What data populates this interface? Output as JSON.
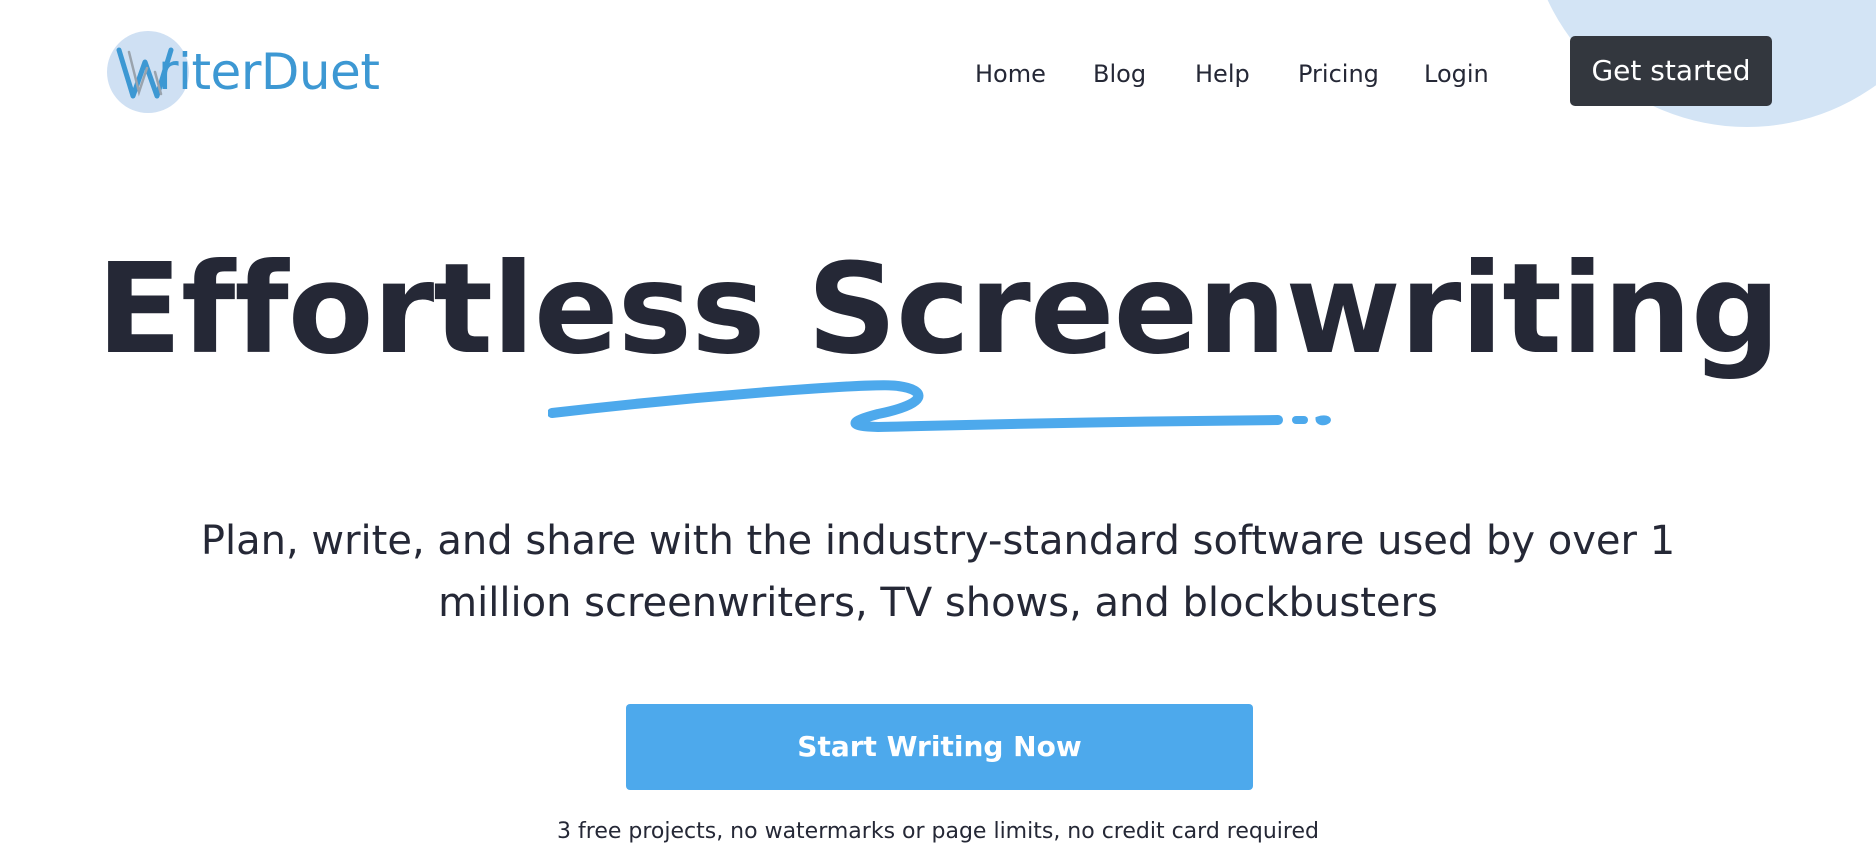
{
  "header": {
    "logo_text": "riterDuet",
    "logo_icon": "writerduet-w-logo-icon",
    "nav": {
      "home": "Home",
      "blog": "Blog",
      "help": "Help",
      "pricing": "Pricing",
      "login": "Login"
    },
    "cta_label": "Get started"
  },
  "hero": {
    "headline": "Effortless Screenwriting",
    "subheadline_line1": "Plan, write, and share with the industry-standard software used by over 1",
    "subheadline_line2": "million screenwriters, TV shows, and blockbusters",
    "cta_label": "Start Writing Now",
    "fine_print": "3 free projects, no watermarks or page limits, no credit card required"
  },
  "colors": {
    "accent_blue": "#4da9ec",
    "logo_blue": "#3d98d3",
    "dark_button": "#33373e",
    "text_dark": "#252836",
    "blob": "#d3e4f5"
  }
}
